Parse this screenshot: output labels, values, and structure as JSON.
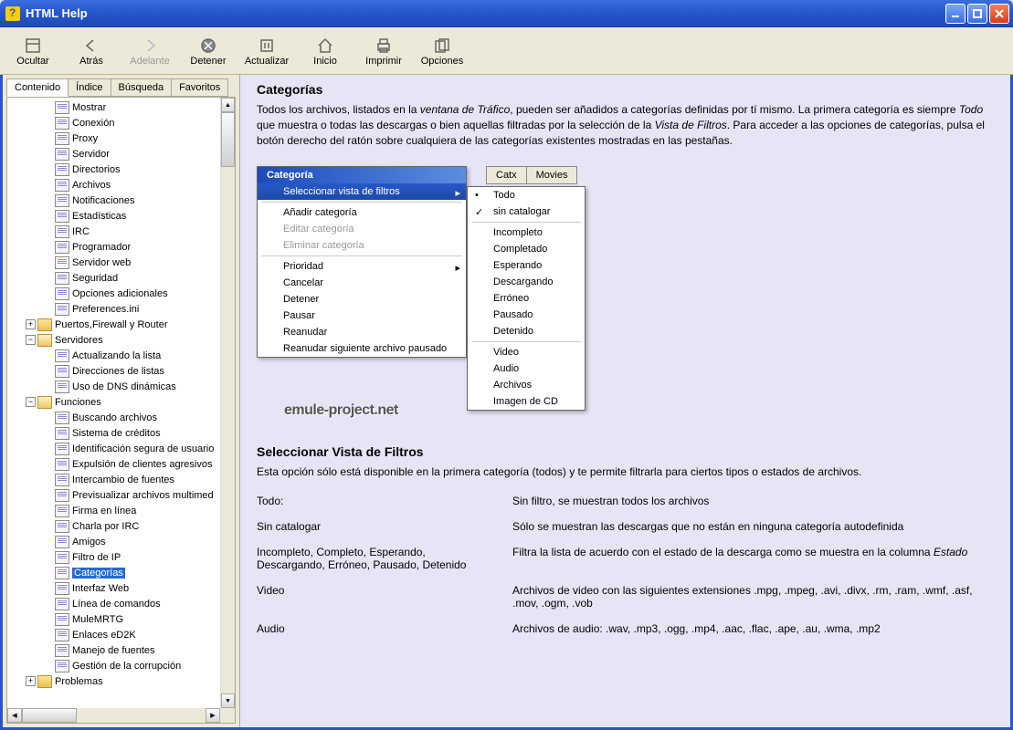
{
  "title": "HTML Help",
  "toolbar": {
    "ocultar": "Ocultar",
    "atras": "Atrás",
    "adelante": "Adelante",
    "detener": "Detener",
    "actualizar": "Actualizar",
    "inicio": "Inicio",
    "imprimir": "Imprimir",
    "opciones": "Opciones"
  },
  "navtabs": {
    "contenido": "Contenido",
    "indice": "Índice",
    "busqueda": "Búsqueda",
    "favoritos": "Favoritos"
  },
  "tree": {
    "mostrar": "Mostrar",
    "conexion": "Conexión",
    "proxy": "Proxy",
    "servidor": "Servidor",
    "directorios": "Directorios",
    "archivos": "Archivos",
    "notificaciones": "Notificaciones",
    "estadisticas": "Estadísticas",
    "irc": "IRC",
    "programador": "Programador",
    "servidorweb": "Servidor web",
    "seguridad": "Seguridad",
    "opcionesadicionales": "Opciones adicionales",
    "preferencesini": "Preferences.ini",
    "puertos": "Puertos,Firewall y Router",
    "servidores": "Servidores",
    "actualizandolista": "Actualizando la lista",
    "direccioneslistas": "Direcciones de listas",
    "usodns": "Uso de DNS dinámicas",
    "funciones": "Funciones",
    "buscandoarchivos": "Buscando archivos",
    "sistemacreditos": "Sistema de créditos",
    "identificacion": "Identificación segura de usuario",
    "expulsion": "Expulsión de clientes agresivos",
    "intercambio": "Intercambio de fuentes",
    "previsualizar": "Previsualizar archivos multimed",
    "firma": "Firma en línea",
    "charla": "Charla por IRC",
    "amigos": "Amigos",
    "filtroip": "Filtro de IP",
    "categorias": "Categorías",
    "interfazweb": "Interfaz Web",
    "lineacomandos": "Línea de comandos",
    "mulemrtg": "MuleMRTG",
    "enlacesed2k": "Enlaces eD2K",
    "manejofuentes": "Manejo de fuentes",
    "gestion": "Gestión de la corrupción",
    "problemas": "Problemas"
  },
  "content": {
    "h1": "Categorías",
    "p1a": "Todos los archivos, listados en la ",
    "p1b": "ventana de Tráfico",
    "p1c": ", pueden ser añadidos a categorías definidas por tí mismo. La primera categoría es siempre ",
    "p1d": "Todo",
    "p1e": " que muestra o todas las descargas o bien aquellas filtradas por la selección de la ",
    "p1f": "Vista de Filtros",
    "p1g": ". Para acceder a las opciones de categorías, pulsa el botón derecho del ratón sobre cualquiera de las categorías existentes mostradas en las pestañas.",
    "cattab1": "Catx",
    "cattab2": "Movies",
    "menu_header": "Categoría",
    "m_seleccionar": "Seleccionar vista de filtros",
    "m_anadir": "Añadir categoría",
    "m_editar": "Editar categoría",
    "m_eliminar": "Eliminar categoría",
    "m_prioridad": "Prioridad",
    "m_cancelar": "Cancelar",
    "m_detener": "Detener",
    "m_pausar": "Pausar",
    "m_reanudar": "Reanudar",
    "m_reanudarsig": "Reanudar siguiente archivo pausado",
    "sm_todo": "Todo",
    "sm_sincat": "sin catalogar",
    "sm_incompleto": "Incompleto",
    "sm_completado": "Completado",
    "sm_esperando": "Esperando",
    "sm_descargando": "Descargando",
    "sm_erroneo": "Erróneo",
    "sm_pausado": "Pausado",
    "sm_detenido": "Detenido",
    "sm_video": "Video",
    "sm_audio": "Audio",
    "sm_archivos": "Archivos",
    "sm_imagen": "Imagen de CD",
    "watermark": "emule-project.net",
    "h2": "Seleccionar Vista de Filtros",
    "p2": "Esta opción sólo está disponible en la primera categoría (todos) y te permite filtrarla para ciertos tipos o estados de archivos.",
    "def": {
      "t1": "Todo:",
      "d1": "Sin filtro, se muestran todos los archivos",
      "t2": "Sin catalogar",
      "d2": "Sólo se muestran las descargas que no están en ninguna categoría autodefinida",
      "t3": "Incompleto, Completo, Esperando, Descargando, Erróneo, Pausado, Detenido",
      "d3a": "Filtra la lista de acuerdo con el estado de la descarga como se muestra en la columna ",
      "d3b": "Estado",
      "t4": "Video",
      "d4": "Archivos de video con las siguientes extensiones .mpg, .mpeg, .avi, .divx, .rm, .ram, .wmf, .asf, .mov, .ogm, .vob",
      "t5": "Audio",
      "d5": "Archivos de audio: .wav, .mp3, .ogg, .mp4, .aac, .flac, .ape, .au, .wma, .mp2"
    }
  }
}
